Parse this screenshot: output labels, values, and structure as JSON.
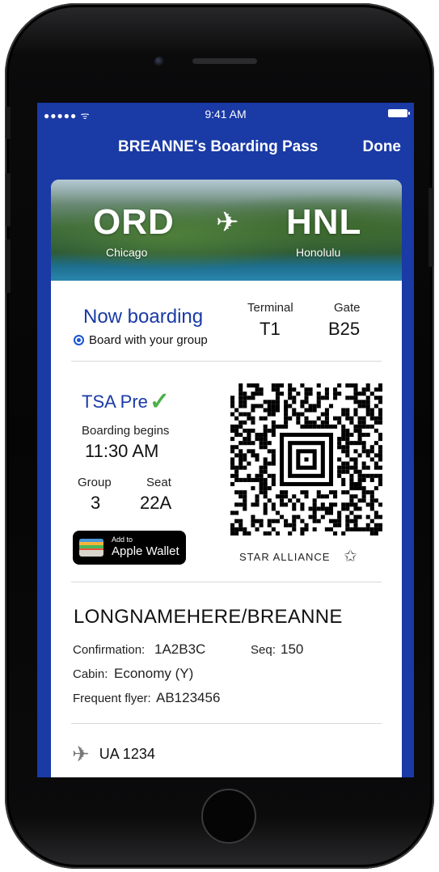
{
  "status_bar": {
    "signal": "●●●●● ᯤ",
    "time": "9:41 AM"
  },
  "nav": {
    "title": "BREANNE's Boarding Pass",
    "done": "Done"
  },
  "route": {
    "from_code": "ORD",
    "from_city": "Chicago",
    "to_code": "HNL",
    "to_city": "Honolulu",
    "plane_icon": "✈"
  },
  "boarding": {
    "status": "Now boarding",
    "group_note": "Board with your group",
    "terminal_label": "Terminal",
    "terminal": "T1",
    "gate_label": "Gate",
    "gate": "B25"
  },
  "tsa": {
    "label": "TSA Pre",
    "check": "✓"
  },
  "times": {
    "boarding_begins_label": "Boarding begins",
    "boarding_begins": "11:30 AM",
    "group_label": "Group",
    "group": "3",
    "seat_label": "Seat",
    "seat": "22A"
  },
  "wallet": {
    "small": "Add to",
    "big": "Apple Wallet"
  },
  "alliance": {
    "label": "STAR ALLIANCE",
    "star_icon": "✩"
  },
  "passenger": {
    "name": "LONGNAMEHERE/BREANNE",
    "confirmation_label": "Confirmation:",
    "confirmation": "1A2B3C",
    "seq_label": "Seq:",
    "seq": "150",
    "cabin_label": "Cabin:",
    "cabin": "Economy (Y)",
    "ff_label": "Frequent flyer:",
    "ff": "AB123456"
  },
  "flight": {
    "plane_icon": "✈",
    "number": "UA 1234"
  },
  "colors": {
    "brand_blue": "#1a3aa6",
    "tsa_green": "#4bb04a"
  }
}
